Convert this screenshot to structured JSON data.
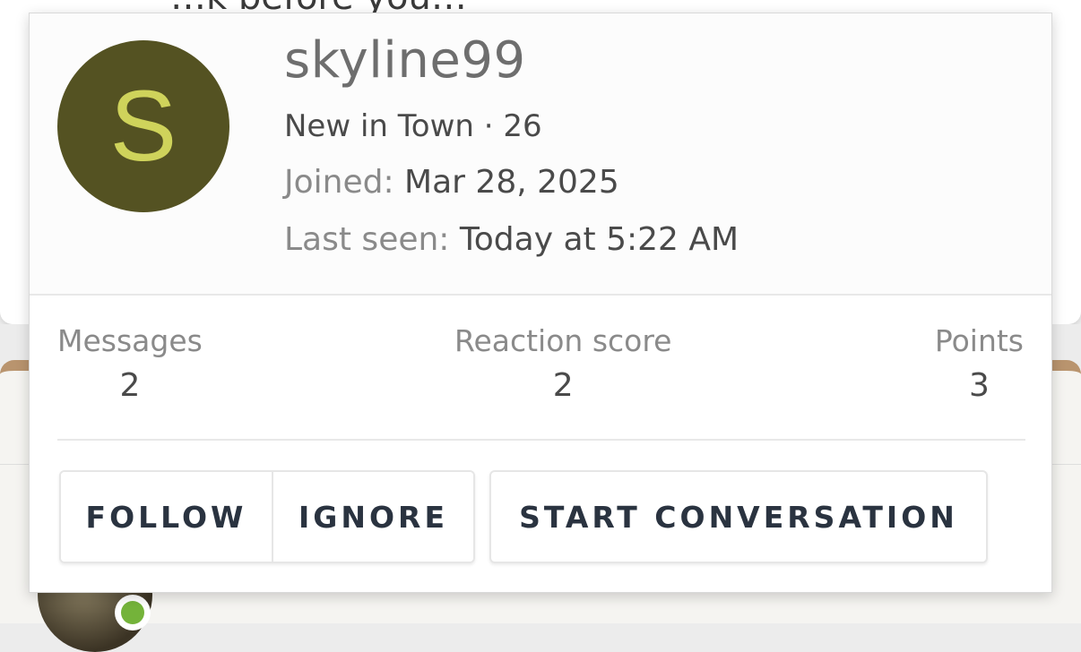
{
  "background": {
    "heading_partial": "…k before you…"
  },
  "member": {
    "avatar_letter": "S",
    "username": "skyline99",
    "user_title": "New in Town · 26",
    "joined_label": "Joined:",
    "joined_value": "Mar 28, 2025",
    "last_seen_label": "Last seen:",
    "last_seen_value": "Today at 5:22 AM"
  },
  "stats": {
    "messages_label": "Messages",
    "messages_value": "2",
    "reaction_label": "Reaction score",
    "reaction_value": "2",
    "points_label": "Points",
    "points_value": "3"
  },
  "actions": {
    "follow_label": "FOLLOW",
    "ignore_label": "IGNORE",
    "conversation_label": "START CONVERSATION"
  },
  "colors": {
    "avatar_bg": "#545222",
    "avatar_letter": "#cfd35b",
    "forum_accent": "#b9946e",
    "online_badge": "#74b33a"
  }
}
